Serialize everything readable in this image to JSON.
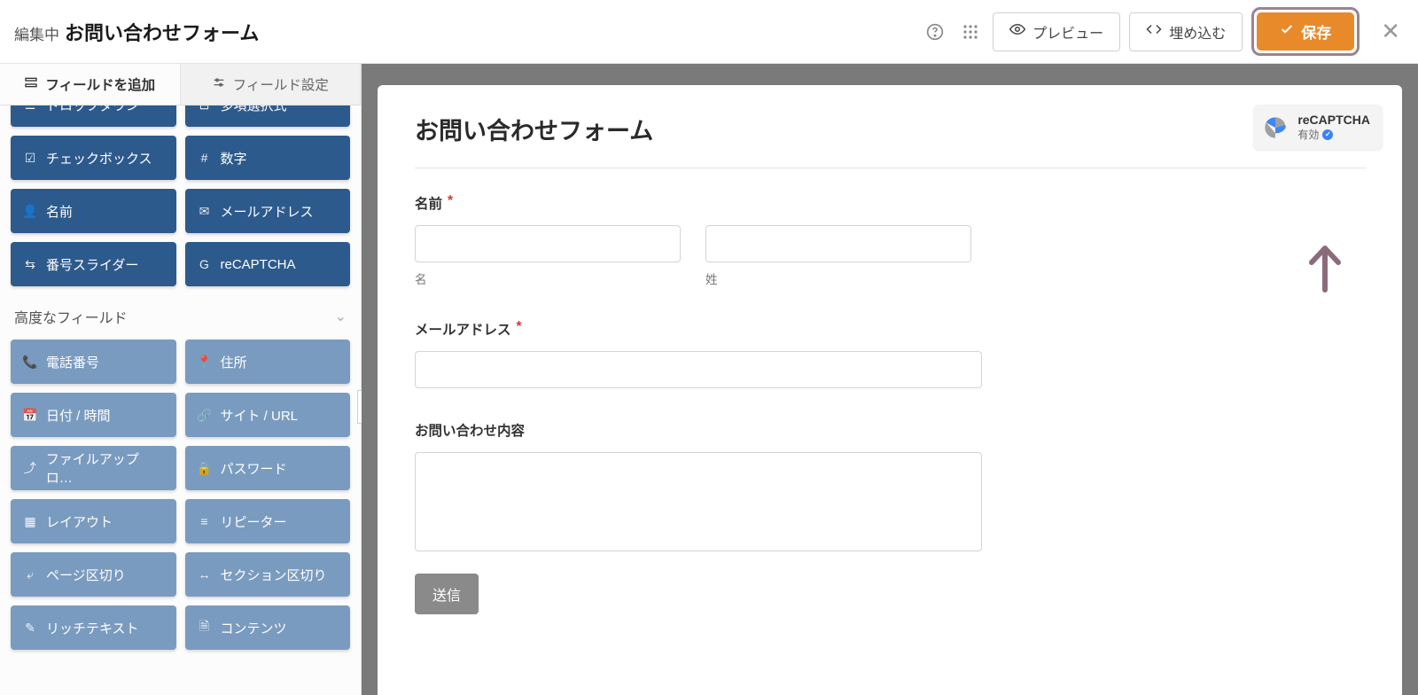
{
  "header": {
    "editing_prefix": "編集中",
    "title": "お問い合わせフォーム",
    "preview_label": "プレビュー",
    "embed_label": "埋め込む",
    "save_label": "保存"
  },
  "sidebar": {
    "tab_add_fields": "フィールドを追加",
    "tab_field_settings": "フィールド設定",
    "basic_fields": [
      {
        "icon": "list-icon",
        "glyph": "☰",
        "label": "ドロップダウン"
      },
      {
        "icon": "multiselect-icon",
        "glyph": "⊟",
        "label": "多項選択式"
      },
      {
        "icon": "checkbox-icon",
        "glyph": "☑",
        "label": "チェックボックス"
      },
      {
        "icon": "hash-icon",
        "glyph": "#",
        "label": "数字"
      },
      {
        "icon": "user-icon",
        "glyph": "👤",
        "label": "名前"
      },
      {
        "icon": "mail-icon",
        "glyph": "✉",
        "label": "メールアドレス"
      },
      {
        "icon": "slider-icon",
        "glyph": "⇆",
        "label": "番号スライダー"
      },
      {
        "icon": "google-icon",
        "glyph": "G",
        "label": "reCAPTCHA"
      }
    ],
    "advanced_header": "高度なフィールド",
    "advanced_fields": [
      {
        "icon": "phone-icon",
        "glyph": "📞",
        "label": "電話番号"
      },
      {
        "icon": "pin-icon",
        "glyph": "📍",
        "label": "住所"
      },
      {
        "icon": "calendar-icon",
        "glyph": "📅",
        "label": "日付 / 時間"
      },
      {
        "icon": "link-icon",
        "glyph": "🔗",
        "label": "サイト / URL"
      },
      {
        "icon": "upload-icon",
        "glyph": "⤴",
        "label": "ファイルアップロ…"
      },
      {
        "icon": "lock-icon",
        "glyph": "🔒",
        "label": "パスワード"
      },
      {
        "icon": "layout-icon",
        "glyph": "▦",
        "label": "レイアウト"
      },
      {
        "icon": "repeater-icon",
        "glyph": "≡",
        "label": "リピーター"
      },
      {
        "icon": "pagebreak-icon",
        "glyph": "⤶",
        "label": "ページ区切り"
      },
      {
        "icon": "sectionbreak-icon",
        "glyph": "↔",
        "label": "セクション区切り"
      },
      {
        "icon": "richtext-icon",
        "glyph": "✎",
        "label": "リッチテキスト"
      },
      {
        "icon": "content-icon",
        "glyph": "🗎",
        "label": "コンテンツ"
      }
    ]
  },
  "form": {
    "title": "お問い合わせフォーム",
    "name_label": "名前",
    "first_sub": "名",
    "last_sub": "姓",
    "email_label": "メールアドレス",
    "message_label": "お問い合わせ内容",
    "submit_label": "送信"
  },
  "recaptcha": {
    "title": "reCAPTCHA",
    "status": "有効"
  }
}
